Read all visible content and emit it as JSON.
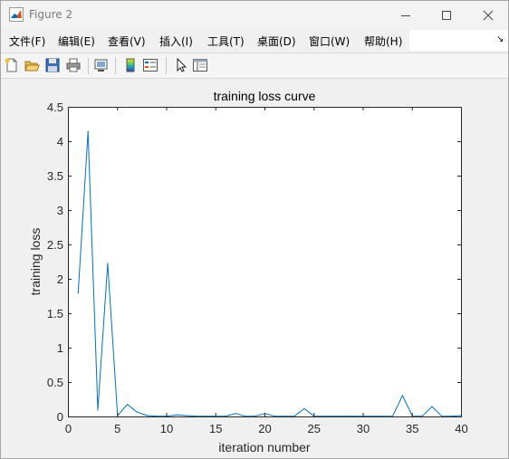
{
  "window": {
    "title": "Figure 2"
  },
  "menu": {
    "items": [
      "文件(F)",
      "编辑(E)",
      "查看(V)",
      "插入(I)",
      "工具(T)",
      "桌面(D)",
      "窗口(W)",
      "帮助(H)"
    ],
    "overflow_glyph": "↘"
  },
  "toolbar": {
    "icons": [
      "new-figure-icon",
      "open-file-icon",
      "save-icon",
      "print-icon",
      "link-plot-icon",
      "colorbar-icon",
      "legend-icon",
      "pointer-icon",
      "property-editor-icon"
    ]
  },
  "colors": {
    "series": "#0072bd",
    "axes": "#262626",
    "plot_bg": "#ffffff",
    "figure_bg": "#f0f0f0"
  },
  "chart_data": {
    "type": "line",
    "title": "training loss curve",
    "xlabel": "iteration number",
    "ylabel": "training loss",
    "xlim": [
      0,
      40
    ],
    "ylim": [
      0,
      4.5
    ],
    "xticks": [
      "0",
      "5",
      "10",
      "15",
      "20",
      "25",
      "30",
      "35",
      "40"
    ],
    "yticks": [
      "0",
      "0.5",
      "1",
      "1.5",
      "2",
      "2.5",
      "3",
      "3.5",
      "4",
      "4.5"
    ],
    "grid": false,
    "series": [
      {
        "x": [
          1,
          2,
          3,
          4,
          5,
          6,
          7,
          8,
          9,
          10,
          11,
          12,
          13,
          14,
          15,
          16,
          17,
          18,
          19,
          20,
          21,
          22,
          23,
          24,
          25,
          26,
          27,
          28,
          29,
          30,
          31,
          32,
          33,
          34,
          35,
          36,
          37,
          38,
          39,
          40
        ],
        "values": [
          1.8,
          4.15,
          0.1,
          2.23,
          0.02,
          0.18,
          0.07,
          0.02,
          0.01,
          0.01,
          0.03,
          0.02,
          0.01,
          0.01,
          0.01,
          0.01,
          0.05,
          0.01,
          0.01,
          0.05,
          0.01,
          0.01,
          0.01,
          0.12,
          0.01,
          0.01,
          0.01,
          0.01,
          0.01,
          0.01,
          0.01,
          0.01,
          0.01,
          0.31,
          0.01,
          0.01,
          0.15,
          0.01,
          0.01,
          0.02
        ]
      }
    ]
  }
}
